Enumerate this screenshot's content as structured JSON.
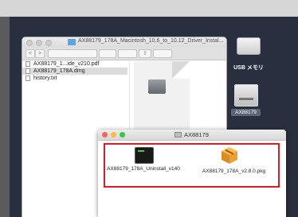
{
  "finder_window": {
    "title": "AX88179_178A_Macintosh_10.6_to_10.12_Driver_Instal...",
    "toolbar": {
      "back": "<",
      "forward": ">",
      "share": "⇧"
    },
    "files": [
      {
        "name": "AX88179_1...ide_v210.pdf",
        "selected": false,
        "icon": "pdf-file-icon"
      },
      {
        "name": "AX88179_178A.dmg",
        "selected": true,
        "icon": "dmg-file-icon"
      },
      {
        "name": "history.txt",
        "selected": false,
        "icon": "text-file-icon"
      }
    ]
  },
  "desktop": {
    "usb_label": "USB メモリ",
    "dmg_label": "AX88179"
  },
  "mounted_window": {
    "title": "AX88179",
    "items": [
      {
        "name": "AX88179_178A_Uninstall_v140",
        "icon": "terminal-script-icon"
      },
      {
        "name": "AX88179_178A_v2.8.0.pkg",
        "icon": "package-icon"
      }
    ],
    "highlight_color": "#e01a22"
  }
}
